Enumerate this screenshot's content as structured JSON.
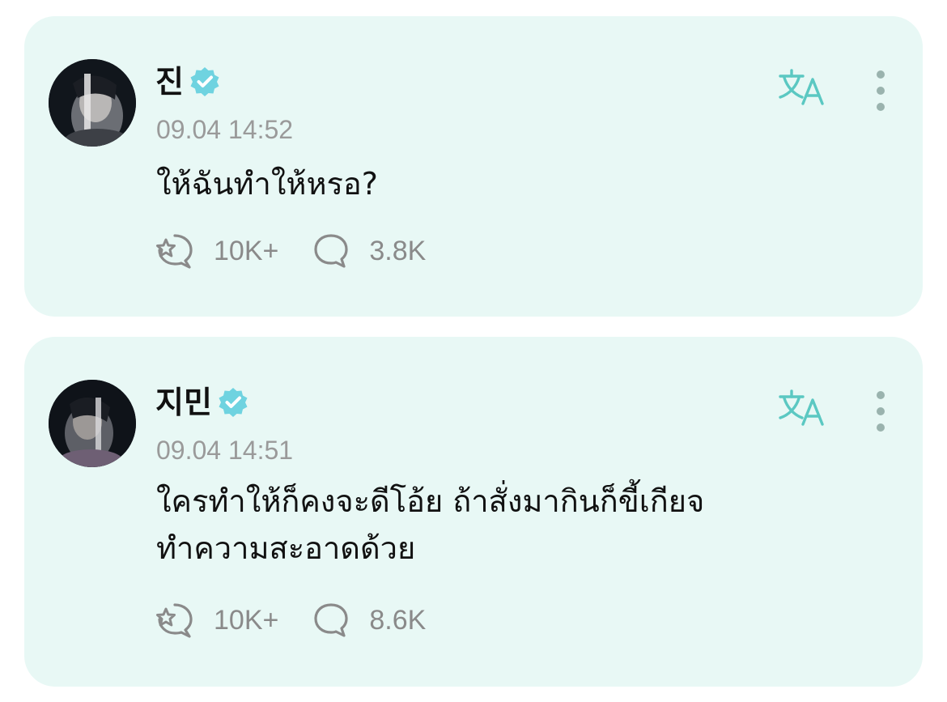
{
  "posts": [
    {
      "author": "진",
      "timestamp": "09.04 14:52",
      "text": "ให้ฉันทำให้หรอ?",
      "likes": "10K+",
      "comments": "3.8K"
    },
    {
      "author": "지민",
      "timestamp": "09.04 14:51",
      "text": "ใครทำให้ก็คงจะดีโอ้ย ถ้าสั่งมากินก็ขี้เกียจ\nทำความสะอาดด้วย",
      "likes": "10K+",
      "comments": "8.6K"
    }
  ],
  "colors": {
    "card_background": "#e8f8f5",
    "accent_teal": "#5bc8c2",
    "muted_gray": "#8a8a8a"
  },
  "icons": {
    "verified": "verified-badge-icon",
    "translate": "translate-icon",
    "more": "more-vertical-icon",
    "like": "like-star-bubble-icon",
    "comment": "comment-bubble-icon"
  }
}
